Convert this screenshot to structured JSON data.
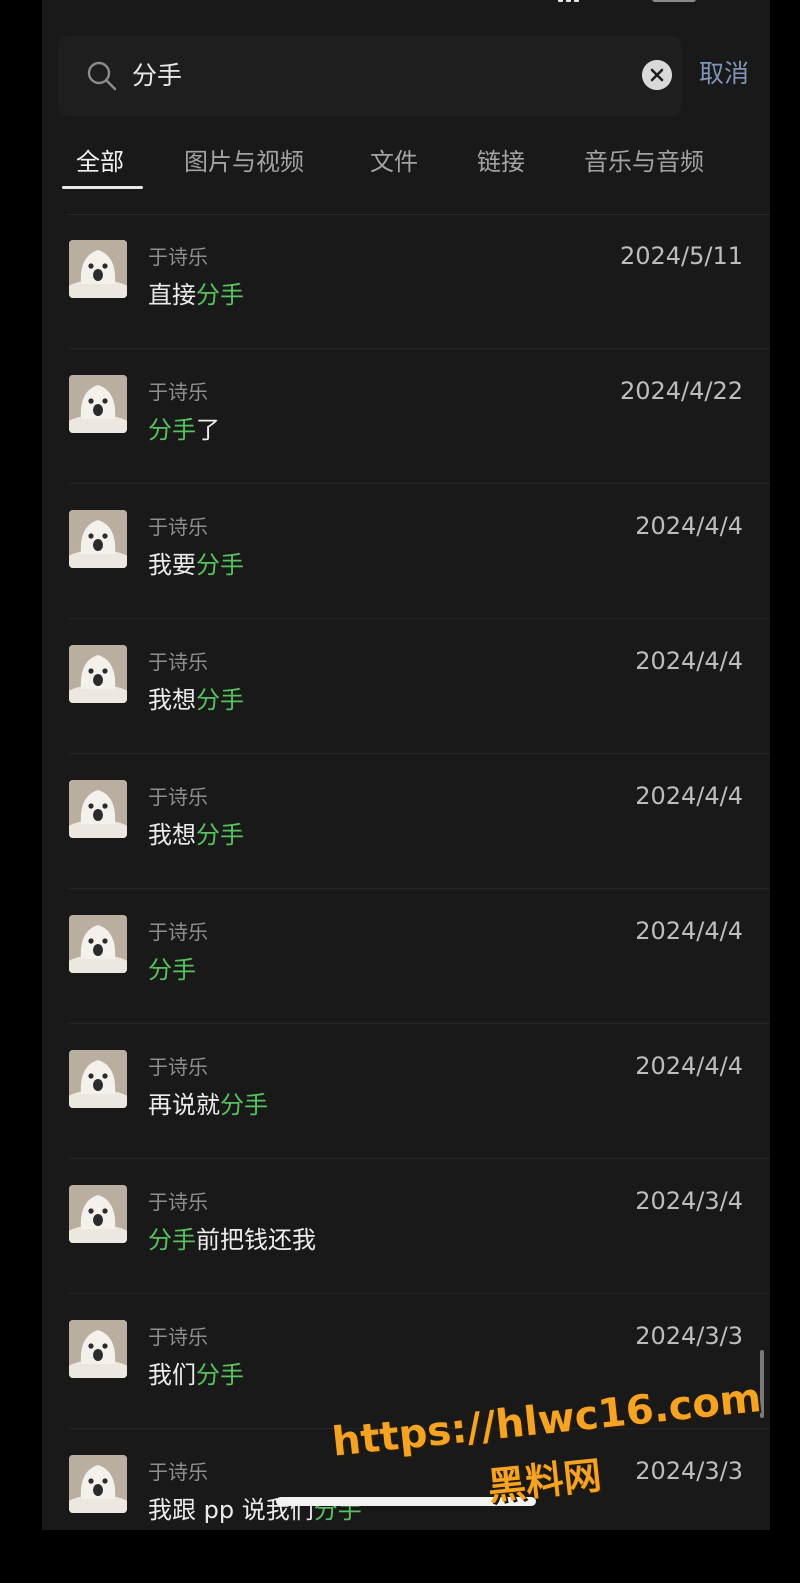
{
  "search": {
    "query": "分手",
    "cancel_label": "取消"
  },
  "tabs": [
    {
      "label": "全部",
      "active": true
    },
    {
      "label": "图片与视频",
      "active": false
    },
    {
      "label": "文件",
      "active": false
    },
    {
      "label": "链接",
      "active": false
    },
    {
      "label": "音乐与音频",
      "active": false
    }
  ],
  "colors": {
    "highlight": "#57c25e",
    "cancel": "#7e95b8",
    "background": "#191919"
  },
  "results": [
    {
      "sender": "于诗乐",
      "date": "2024/5/11",
      "pre": "直接",
      "hl": "分手",
      "post": ""
    },
    {
      "sender": "于诗乐",
      "date": "2024/4/22",
      "pre": "",
      "hl": "分手",
      "post": "了"
    },
    {
      "sender": "于诗乐",
      "date": "2024/4/4",
      "pre": "我要",
      "hl": "分手",
      "post": ""
    },
    {
      "sender": "于诗乐",
      "date": "2024/4/4",
      "pre": "我想",
      "hl": "分手",
      "post": ""
    },
    {
      "sender": "于诗乐",
      "date": "2024/4/4",
      "pre": "我想",
      "hl": "分手",
      "post": ""
    },
    {
      "sender": "于诗乐",
      "date": "2024/4/4",
      "pre": "",
      "hl": "分手",
      "post": ""
    },
    {
      "sender": "于诗乐",
      "date": "2024/4/4",
      "pre": "再说就",
      "hl": "分手",
      "post": ""
    },
    {
      "sender": "于诗乐",
      "date": "2024/3/4",
      "pre": "",
      "hl": "分手",
      "post": "前把钱还我"
    },
    {
      "sender": "于诗乐",
      "date": "2024/3/3",
      "pre": "我们",
      "hl": "分手",
      "post": ""
    },
    {
      "sender": "于诗乐",
      "date": "2024/3/3",
      "pre": "我跟 pp 说我们",
      "hl": "分手",
      "post": ""
    }
  ],
  "watermark": {
    "url": "https://hlwc16.com",
    "name": "黑料网"
  }
}
